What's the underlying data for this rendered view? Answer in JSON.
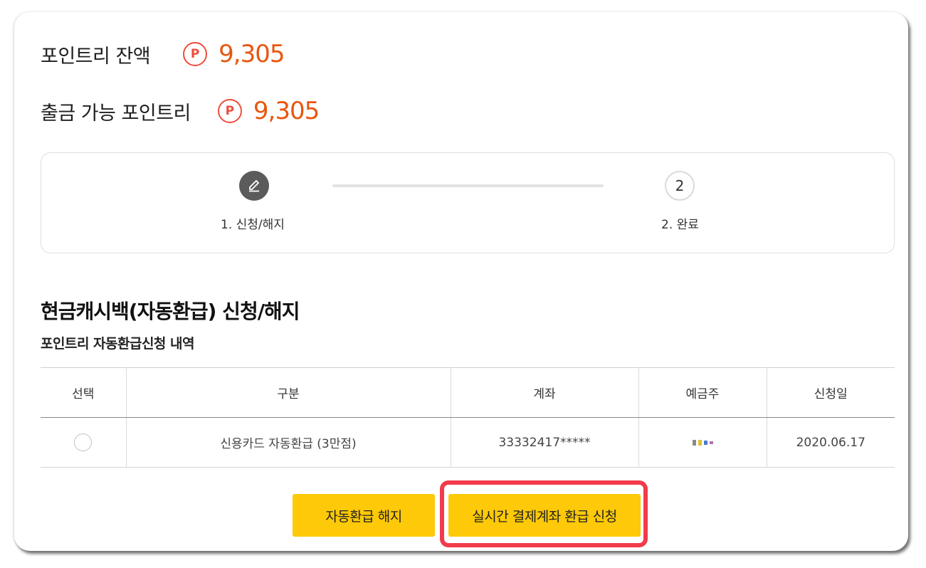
{
  "balance": {
    "point_label": "포인트리 잔액",
    "point_badge": "P",
    "point_amount": "9,305",
    "withdrawable_label": "출금 가능 포인트리",
    "withdrawable_badge": "P",
    "withdrawable_amount": "9,305"
  },
  "steps": {
    "items": [
      {
        "number": "1",
        "label": "1. 신청/해지",
        "icon": "pencil-icon",
        "active": true
      },
      {
        "number": "2",
        "label": "2. 완료",
        "active": false
      }
    ]
  },
  "section": {
    "title": "현금캐시백(자동환급) 신청/해지",
    "subtitle": "포인트리 자동환급신청 내역"
  },
  "table": {
    "headers": [
      "선택",
      "구분",
      "계좌",
      "예금주",
      "신청일"
    ],
    "rows": [
      {
        "type": "신용카드 자동환급 (3만점)",
        "account": "33332417*****",
        "date": "2020.06.17"
      }
    ]
  },
  "buttons": {
    "cancel_label": "자동환급 해지",
    "apply_label": "실시간 결제계좌 환급 신청"
  },
  "colors": {
    "accent_orange": "#e8560e",
    "badge_red": "#ef4d3c",
    "button_yellow": "#fec908",
    "highlight_red": "#f23b4b",
    "step_active": "#5b5b5b"
  }
}
